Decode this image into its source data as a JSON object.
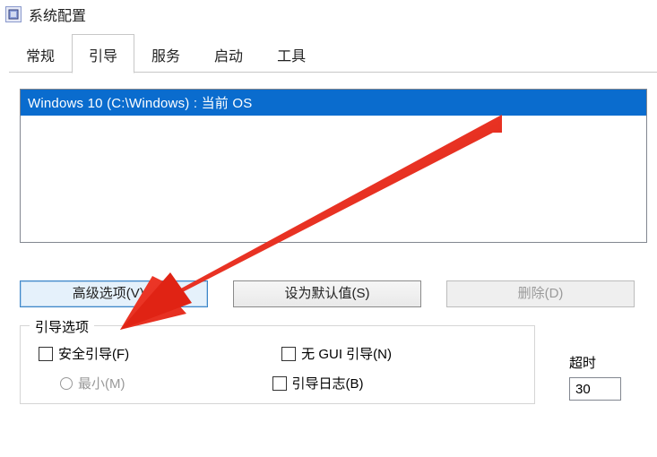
{
  "window": {
    "title": "系统配置"
  },
  "tabs": {
    "general": "常规",
    "boot": "引导",
    "services": "服务",
    "startup": "启动",
    "tools": "工具"
  },
  "boot": {
    "os_entry": "Windows 10 (C:\\Windows) : 当前 OS",
    "buttons": {
      "advanced": "高级选项(V)...",
      "set_default": "设为默认值(S)",
      "delete": "删除(D)"
    },
    "group": {
      "title": "引导选项",
      "safe_boot": "安全引导(F)",
      "minimal": "最小(M)",
      "no_gui": "无 GUI 引导(N)",
      "boot_log": "引导日志(B)"
    },
    "timeout": {
      "label": "超时",
      "value": "30"
    }
  }
}
